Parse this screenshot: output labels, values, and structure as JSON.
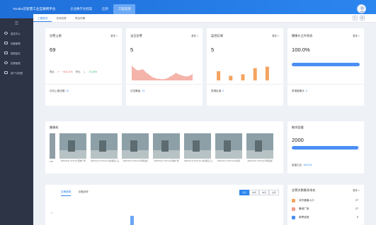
{
  "brand": "Yonder云智慧工业互联网平台",
  "topnav": [
    {
      "label": "企业数字化档案"
    },
    {
      "label": "应用"
    },
    {
      "label": "工程监测",
      "active": true
    }
  ],
  "tabs": [
    {
      "label": "工程首页",
      "active": true
    },
    {
      "label": "总体态势"
    },
    {
      "label": "项目详情"
    }
  ],
  "sidebar": {
    "toggle": "☰",
    "items": [
      {
        "label": "监控中心",
        "icon": "circle-icon"
      },
      {
        "label": "设备管理",
        "icon": "device-icon"
      },
      {
        "label": "视频监控",
        "icon": "monitor-icon"
      },
      {
        "label": "告警管理",
        "icon": "alert-icon"
      },
      {
        "label": "用户与权限",
        "icon": "user-icon"
      }
    ]
  },
  "cards": {
    "alarm_report": {
      "title": "告警上报",
      "more": "更多 >",
      "value": "69",
      "trend_up_label": "同比",
      "trend_up_value": "+102.11%",
      "trend_down_label": "环比",
      "trend_down_value": "-71.43%",
      "foot_label": "日均上报次数",
      "foot_value": "11"
    },
    "today_alarm": {
      "title": "当日告警",
      "more": "更多 >",
      "value": "5",
      "foot_label": "日告警量",
      "foot_value": "13",
      "chart_data": {
        "type": "area",
        "x": [
          "00:00",
          "02:00",
          "04:00",
          "06:00",
          "08:00",
          "10:00",
          "12:00",
          "14:00",
          "16:00",
          "18:00",
          "20:00",
          "22:00"
        ],
        "values": [
          12,
          8,
          9,
          5,
          2,
          1,
          1,
          3,
          6,
          4,
          3,
          5
        ],
        "color": "#f19b8e",
        "ylim": [
          0,
          15
        ]
      }
    },
    "alarm_area": {
      "title": "监控区域",
      "more": "更多 >",
      "value": "5",
      "foot_label": "异常区域",
      "foot_value": "0",
      "chart_data": {
        "type": "bar",
        "categories": [
          "A",
          "B",
          "C",
          "D",
          "E"
        ],
        "values": [
          6,
          3,
          4,
          8,
          9
        ],
        "color": "#f4a460",
        "ylim": [
          0,
          12
        ]
      }
    },
    "online_rate": {
      "title": "摄像头工作状态",
      "more": "更多 >",
      "value": "100.0%",
      "progress": 1.0,
      "foot_label": "异常摄像头",
      "foot_value": "0"
    },
    "cameras": {
      "title": "摄像机",
      "items": [
        {
          "caption": "2020-03-11 15:51:22\n警戒广场"
        },
        {
          "caption": "2020-03-11 15:51:22\n对外通道入口"
        },
        {
          "caption": "2020-03-11 15:51:22\n周界巡视"
        },
        {
          "caption": "2020-03-11 15:51:22\n警戒广场"
        },
        {
          "caption": "2020-03-11 15:51:22\n对外通道入口"
        },
        {
          "caption": "2020-03-11 15:51:22\n作业区"
        },
        {
          "caption": "2020-03-11 15:51:22\n周界巡视"
        },
        {
          "caption": "2020-03-11 15:51:22\n作业区"
        }
      ],
      "left_caption": "0.00"
    },
    "capacity": {
      "title": "剩余容量",
      "value": "2000",
      "progress": 0.98,
      "foot_label": "容量占比",
      "foot_value": "100.0%"
    },
    "trend": {
      "tabs": [
        {
          "label": "告警趋势",
          "active": true
        },
        {
          "label": "设备趋势"
        }
      ],
      "ranges": [
        {
          "label": "今日",
          "active": true
        },
        {
          "label": "本周"
        },
        {
          "label": "本月"
        },
        {
          "label": "全年"
        }
      ],
      "ytick": "8"
    },
    "ranking": {
      "title": "告警次数最多排名",
      "more": "更多 >",
      "rows": [
        {
          "label": "对外通道入口",
          "value": "27",
          "color": "#f4a460"
        },
        {
          "label": "警戒广场",
          "value": "27",
          "color": "#f19b8e"
        },
        {
          "label": "周界巡视",
          "value": "9",
          "color": "#4b8ef4"
        }
      ]
    }
  }
}
